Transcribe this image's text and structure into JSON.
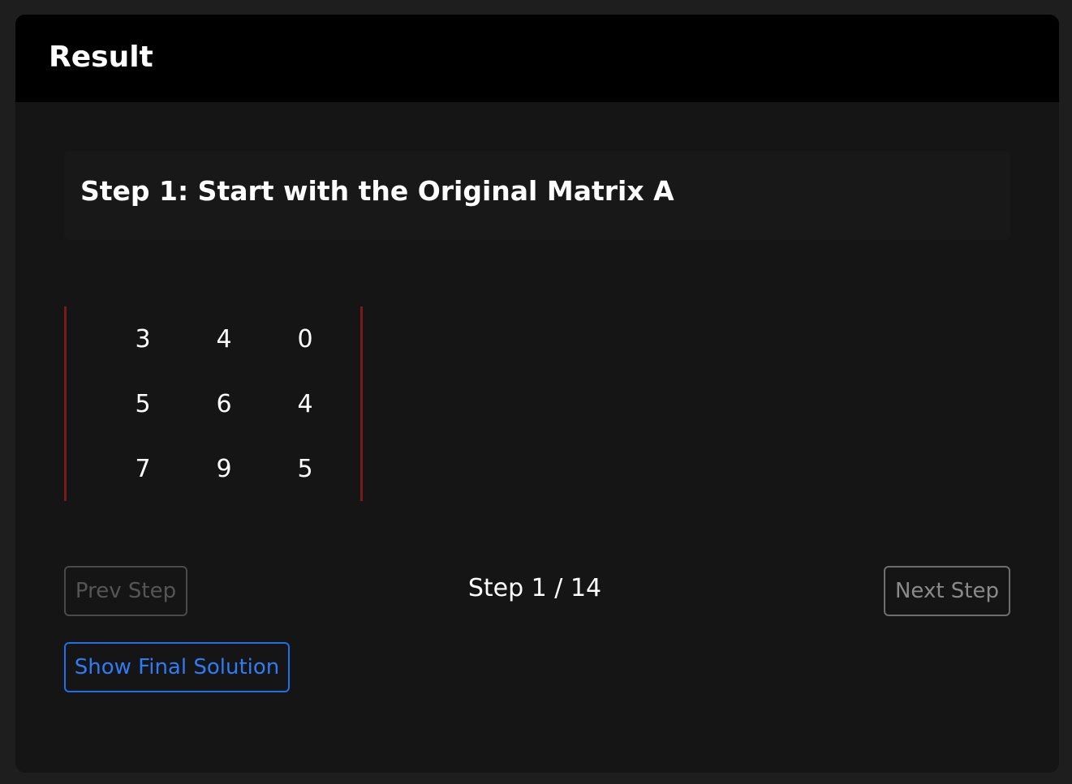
{
  "header": {
    "title": "Result"
  },
  "step": {
    "title": "Step 1: Start with the Original Matrix A"
  },
  "matrix": {
    "rows": [
      [
        "3",
        "4",
        "0"
      ],
      [
        "5",
        "6",
        "4"
      ],
      [
        "7",
        "9",
        "5"
      ]
    ],
    "bracket_color": "#7a1a1a"
  },
  "navigation": {
    "prev_label": "Prev Step",
    "next_label": "Next Step",
    "counter": "Step 1 / 14",
    "final_label": "Show Final Solution"
  },
  "colors": {
    "background": "#1e1e1e",
    "card": "#151515",
    "header": "#000000",
    "accent": "#1f6feb"
  }
}
